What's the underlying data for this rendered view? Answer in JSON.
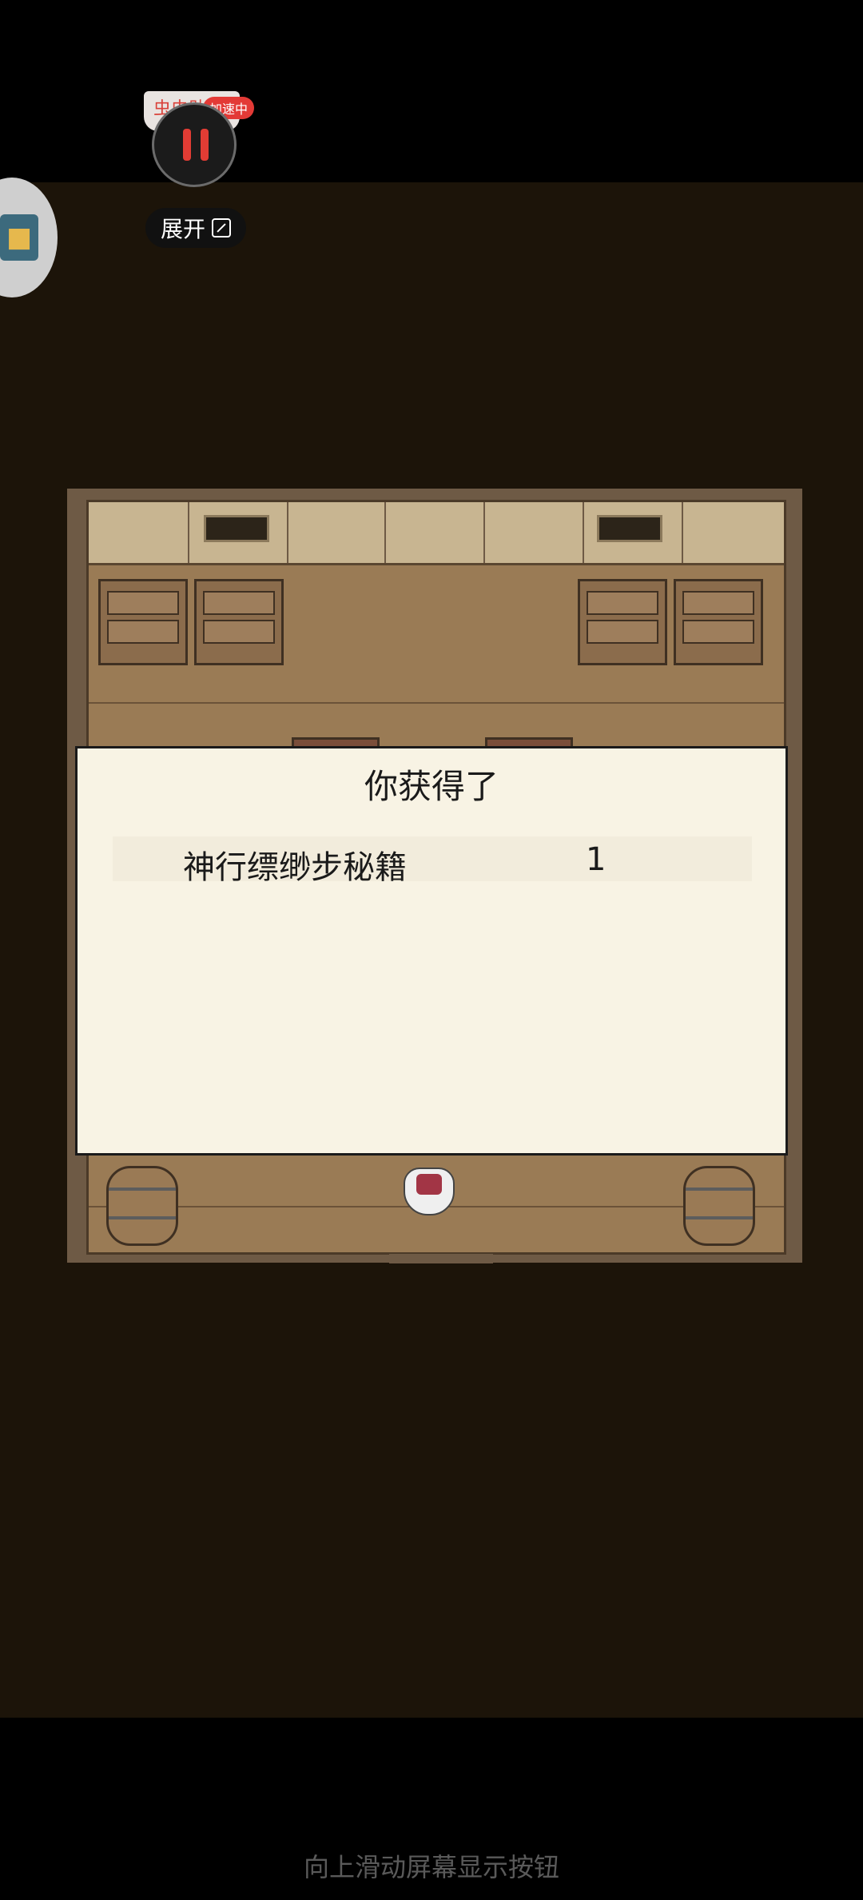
{
  "overlay": {
    "assist_label": "虫虫助",
    "accel_badge": "加速中",
    "expand_label": "展开",
    "pause_icon": "pause-icon",
    "expand_icon": "expand-icon",
    "side_logo_icon": "app-logo-icon"
  },
  "dialog": {
    "title": "你获得了",
    "items": [
      {
        "name": "神行缥缈步秘籍",
        "qty": "1"
      }
    ]
  },
  "system": {
    "gesture_hint": "向上滑动屏幕显示按钮"
  },
  "colors": {
    "game_background": "#1c1409",
    "dialog_background": "#f8f3e4",
    "accent_red": "#e23c34"
  }
}
